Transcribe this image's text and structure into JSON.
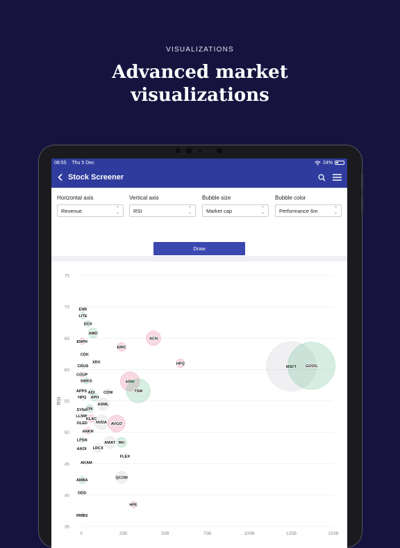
{
  "promo": {
    "eyebrow": "VISUALIZATIONS",
    "headline_line1": "Advanced market",
    "headline_line2": "visualizations"
  },
  "status_bar": {
    "time": "08:55",
    "date": "Thu 5 Dec",
    "battery": "24%"
  },
  "app_bar": {
    "title": "Stock Screener",
    "back_icon": "chevron-left-icon",
    "search_icon": "search-icon",
    "menu_icon": "hamburger-menu-icon"
  },
  "controls": {
    "horizontal": {
      "label": "Horizontal axis",
      "value": "Revenue"
    },
    "vertical": {
      "label": "Vertical axis",
      "value": "RSI"
    },
    "size": {
      "label": "Bubble size",
      "value": "Market cap"
    },
    "color": {
      "label": "Bubble color",
      "value": "Performance 6m"
    },
    "draw_label": "Draw"
  },
  "chart_data": {
    "type": "scatter",
    "ylabel": "RSI",
    "xlabel": "",
    "ylim": [
      35,
      75
    ],
    "yticks": [
      75,
      70,
      65,
      60,
      55,
      50,
      45,
      40,
      35
    ],
    "xlim": [
      0,
      150
    ],
    "xticks": [
      "0",
      "25B",
      "50B",
      "75B",
      "100B",
      "125B",
      "150B"
    ],
    "grid": true,
    "colors": {
      "positive": "#43b07a",
      "negative": "#e0527a",
      "neutral": "#b9bcc4"
    },
    "points": [
      {
        "label": "ENR",
        "x": 1,
        "y": 69.6,
        "size": 2,
        "perf": 0
      },
      {
        "label": "LITE",
        "x": 1,
        "y": 68.6,
        "size": 3,
        "perf": 1
      },
      {
        "label": "DOX",
        "x": 4,
        "y": 67.3,
        "size": 3,
        "perf": 1
      },
      {
        "label": "AMD",
        "x": 7,
        "y": 65.8,
        "size": 6,
        "perf": 1
      },
      {
        "label": "ENPH",
        "x": 0.5,
        "y": 64.5,
        "size": 3,
        "perf": -1
      },
      {
        "label": "ERIC",
        "x": 24,
        "y": 63.6,
        "size": 5,
        "perf": -1
      },
      {
        "label": "ACN",
        "x": 43,
        "y": 65.0,
        "size": 10,
        "perf": -1
      },
      {
        "label": "CDK",
        "x": 2,
        "y": 62.4,
        "size": 2,
        "perf": 0
      },
      {
        "label": "XRX",
        "x": 9,
        "y": 61.2,
        "size": 2,
        "perf": 0
      },
      {
        "label": "CRUS",
        "x": 1,
        "y": 60.6,
        "size": 2,
        "perf": 1
      },
      {
        "label": "HPQ",
        "x": 59,
        "y": 61.0,
        "size": 5,
        "perf": -1
      },
      {
        "label": "MSFT",
        "x": 125,
        "y": 60.5,
        "size": 40,
        "perf": 0
      },
      {
        "label": "GOOG",
        "x": 137,
        "y": 60.6,
        "size": 38,
        "perf": 1
      },
      {
        "label": "COUP",
        "x": 0.5,
        "y": 59.2,
        "size": 2,
        "perf": -1
      },
      {
        "label": "SWKS",
        "x": 3,
        "y": 58.2,
        "size": 3,
        "perf": 1
      },
      {
        "label": "ARW",
        "x": 29,
        "y": 58.1,
        "size": 14,
        "perf": -1
      },
      {
        "label": "TSM",
        "x": 34,
        "y": 56.6,
        "size": 18,
        "perf": 1
      },
      {
        "label": "APPS",
        "x": 0.2,
        "y": 56.6,
        "size": 2,
        "perf": 0
      },
      {
        "label": "ADI",
        "x": 6,
        "y": 56.4,
        "size": 3,
        "perf": 1
      },
      {
        "label": "CDW",
        "x": 16,
        "y": 56.4,
        "size": 3,
        "perf": 0
      },
      {
        "label": "HPQ",
        "x": 0.5,
        "y": 55.6,
        "size": 2,
        "perf": 0
      },
      {
        "label": "APH",
        "x": 8,
        "y": 55.6,
        "size": 4,
        "perf": 1
      },
      {
        "label": "ASML",
        "x": 13,
        "y": 54.5,
        "size": 8,
        "perf": 0
      },
      {
        "label": "SYNA",
        "x": 0.5,
        "y": 53.6,
        "size": 2,
        "perf": 0
      },
      {
        "label": "ON",
        "x": 5,
        "y": 53.8,
        "size": 4,
        "perf": 1
      },
      {
        "label": "LLNW",
        "x": 0.2,
        "y": 52.6,
        "size": 2,
        "perf": 0
      },
      {
        "label": "KLAC",
        "x": 6,
        "y": 52.2,
        "size": 4,
        "perf": -1
      },
      {
        "label": "OLED",
        "x": 0.5,
        "y": 51.5,
        "size": 2,
        "perf": 0
      },
      {
        "label": "NVDA",
        "x": 12,
        "y": 51.6,
        "size": 10,
        "perf": 0
      },
      {
        "label": "AVGO",
        "x": 21,
        "y": 51.4,
        "size": 12,
        "perf": -1
      },
      {
        "label": "ANKR",
        "x": 4,
        "y": 50.2,
        "size": 3,
        "perf": -1
      },
      {
        "label": "LPSN",
        "x": 0.5,
        "y": 48.8,
        "size": 2,
        "perf": 1
      },
      {
        "label": "AMAT",
        "x": 17,
        "y": 48.4,
        "size": 8,
        "perf": 0
      },
      {
        "label": "MU",
        "x": 24,
        "y": 48.4,
        "size": 6,
        "perf": 1
      },
      {
        "label": "LRCX",
        "x": 10,
        "y": 47.5,
        "size": 5,
        "perf": 0
      },
      {
        "label": "AAOI",
        "x": 0.2,
        "y": 47.4,
        "size": 2,
        "perf": 0
      },
      {
        "label": "FLEX",
        "x": 26,
        "y": 46.2,
        "size": 3,
        "perf": 0
      },
      {
        "label": "AKAM",
        "x": 3,
        "y": 45.2,
        "size": 2,
        "perf": 0
      },
      {
        "label": "QCOM",
        "x": 24,
        "y": 42.8,
        "size": 8,
        "perf": 0
      },
      {
        "label": "AMBA",
        "x": 0.5,
        "y": 42.4,
        "size": 4,
        "perf": 1
      },
      {
        "label": "DDD",
        "x": 0.5,
        "y": 40.4,
        "size": 2,
        "perf": 0
      },
      {
        "label": "HPE",
        "x": 31,
        "y": 38.5,
        "size": 3,
        "perf": -1
      },
      {
        "label": "RMBS",
        "x": 0.5,
        "y": 36.8,
        "size": 2,
        "perf": 0
      }
    ]
  }
}
